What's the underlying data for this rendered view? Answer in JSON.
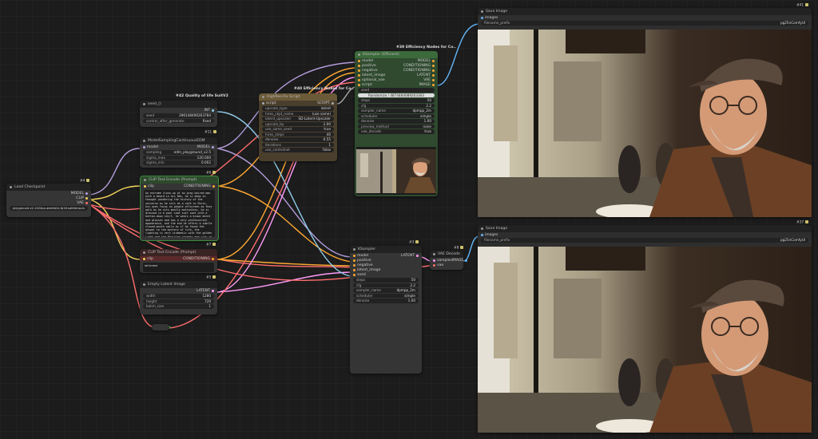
{
  "badges": {
    "n41": "#41",
    "n11": "#11",
    "n4": "#4",
    "n6": "#6",
    "n7": "#7",
    "n5": "#5",
    "n3": "#3",
    "n8": "#8",
    "n37": "#37"
  },
  "load_checkpoint": {
    "title": "Load Checkpoint",
    "out_model": "MODEL",
    "out_clip": "CLIP",
    "out_vae": "VAE",
    "ckpt": "playground-v2-1024px-aesthetic.fp16.safetensors"
  },
  "seed_node": {
    "title": "seed_()",
    "out": "INT",
    "seed_label": "seed",
    "seed_value": "396148490263784",
    "cag_label": "control_after_generate",
    "cag_value": "fixed"
  },
  "msc_node": {
    "title": "ModelSamplingContinuousEDM",
    "in_model": "model",
    "out_model": "MODEL",
    "sampling_label": "sampling",
    "sampling_value": "edm_playground_v2.5",
    "sigma_max_label": "sigma_max",
    "sigma_max_value": "120.000",
    "sigma_min_label": "sigma_min",
    "sigma_min_value": "0.002"
  },
  "clip_pos": {
    "title": "CLIP Text Encode (Prompt)",
    "in_clip": "clip",
    "out": "CONDITIONING",
    "text": "An extreme close-up of an gray-haired man with a beard in his 60s, he is deep in thought pondering the history of the universe as he sits at a cafe in Paris, his eyes focus on people offscreen as they walk as he sits mostly motionless, he is dressed in a wool coat suit coat with a button-down shirt, he wears a brown beret and glasses and has a very professorial appearance, and the end he offers a subtle closed-mouth smile as if he found the answer to the mystery of life, the lighting is very cinematic with the golden light and the Parisian streets and city in the background, depth of field, cinematic 35mm film"
  },
  "clip_neg": {
    "title": "CLIP Text Encode (Prompt)",
    "in_clip": "clip",
    "out": "CONDITIONING",
    "text": "deformed"
  },
  "empty_latent": {
    "title": "Empty Latent Image",
    "out": "LATENT",
    "width_label": "width",
    "width_value": "1280",
    "height_label": "height",
    "height_value": "720",
    "batch_label": "batch_size",
    "batch_value": "1"
  },
  "quality": {
    "title": "#42 Quality of life SuitV2"
  },
  "hiresfix": {
    "header_title": "#40 Efficiency Nodes for Co..",
    "title": "HighRes-Fix Script",
    "in_script": "script",
    "out_script": "SCRIPT",
    "rows": [
      [
        "upscale_type",
        "latent"
      ],
      [
        "hires_ckpt_name",
        "(use same)"
      ],
      [
        "latent_upscaler",
        "SD-Latent-Upscaler"
      ],
      [
        "upscale_by",
        "2.00"
      ],
      [
        "use_same_seed",
        "true"
      ],
      [
        "hires_steps",
        "40"
      ],
      [
        "denoise",
        "0.55"
      ],
      [
        "iterations",
        "1"
      ],
      [
        "use_controlnet",
        "false"
      ]
    ]
  },
  "ksampler_eff": {
    "header_title": "#39 Efficiency Nodes for Co..",
    "title": "KSampler (Efficient)",
    "inputs": [
      "model",
      "positive",
      "negative",
      "latent_image",
      "optional_vae",
      "script"
    ],
    "outputs": [
      "MODEL",
      "CONDITIONING",
      "CONDITIONING",
      "LATENT",
      "VAE",
      "IMAGE"
    ],
    "seed_label": "seed",
    "seed_value": "4874484089203303",
    "seed_mode": "Randomize / 4874484089203303",
    "rows": [
      [
        "steps",
        "50"
      ],
      [
        "cfg",
        "2.2"
      ],
      [
        "sampler_name",
        "dpmpp_2m"
      ],
      [
        "scheduler",
        "simple"
      ],
      [
        "denoise",
        "1.00"
      ],
      [
        "preview_method",
        "none"
      ],
      [
        "vae_decode",
        "true"
      ]
    ]
  },
  "ksampler": {
    "title": "KSampler",
    "inputs": [
      "model",
      "positive",
      "negative",
      "latent_image",
      "seed"
    ],
    "out": "LATENT",
    "rows": [
      [
        "steps",
        "50"
      ],
      [
        "cfg",
        "2.2"
      ],
      [
        "sampler_name",
        "dpmpp_2m"
      ],
      [
        "scheduler",
        "simple"
      ],
      [
        "denoise",
        "1.00"
      ]
    ]
  },
  "vae_decode": {
    "title": "VAE Decode",
    "in_samples": "samples",
    "in_vae": "vae",
    "out": "IMAGE"
  },
  "save1": {
    "title": "Save Image",
    "in_images": "images",
    "prefix_label": "filename_prefix",
    "prefix_value": "pg25nComfyUI"
  },
  "save2": {
    "title": "Save Image",
    "in_images": "images",
    "prefix_label": "filename_prefix",
    "prefix_value": "pg25nComfyUI"
  },
  "colors": {
    "model": "#b39ddb",
    "clip": "#f6d55c",
    "vae": "#ff6e6e",
    "conditioning": "#ffa931",
    "latent": "#ff9cf9",
    "image": "#64b5f6",
    "int": "#8fcbe8"
  }
}
